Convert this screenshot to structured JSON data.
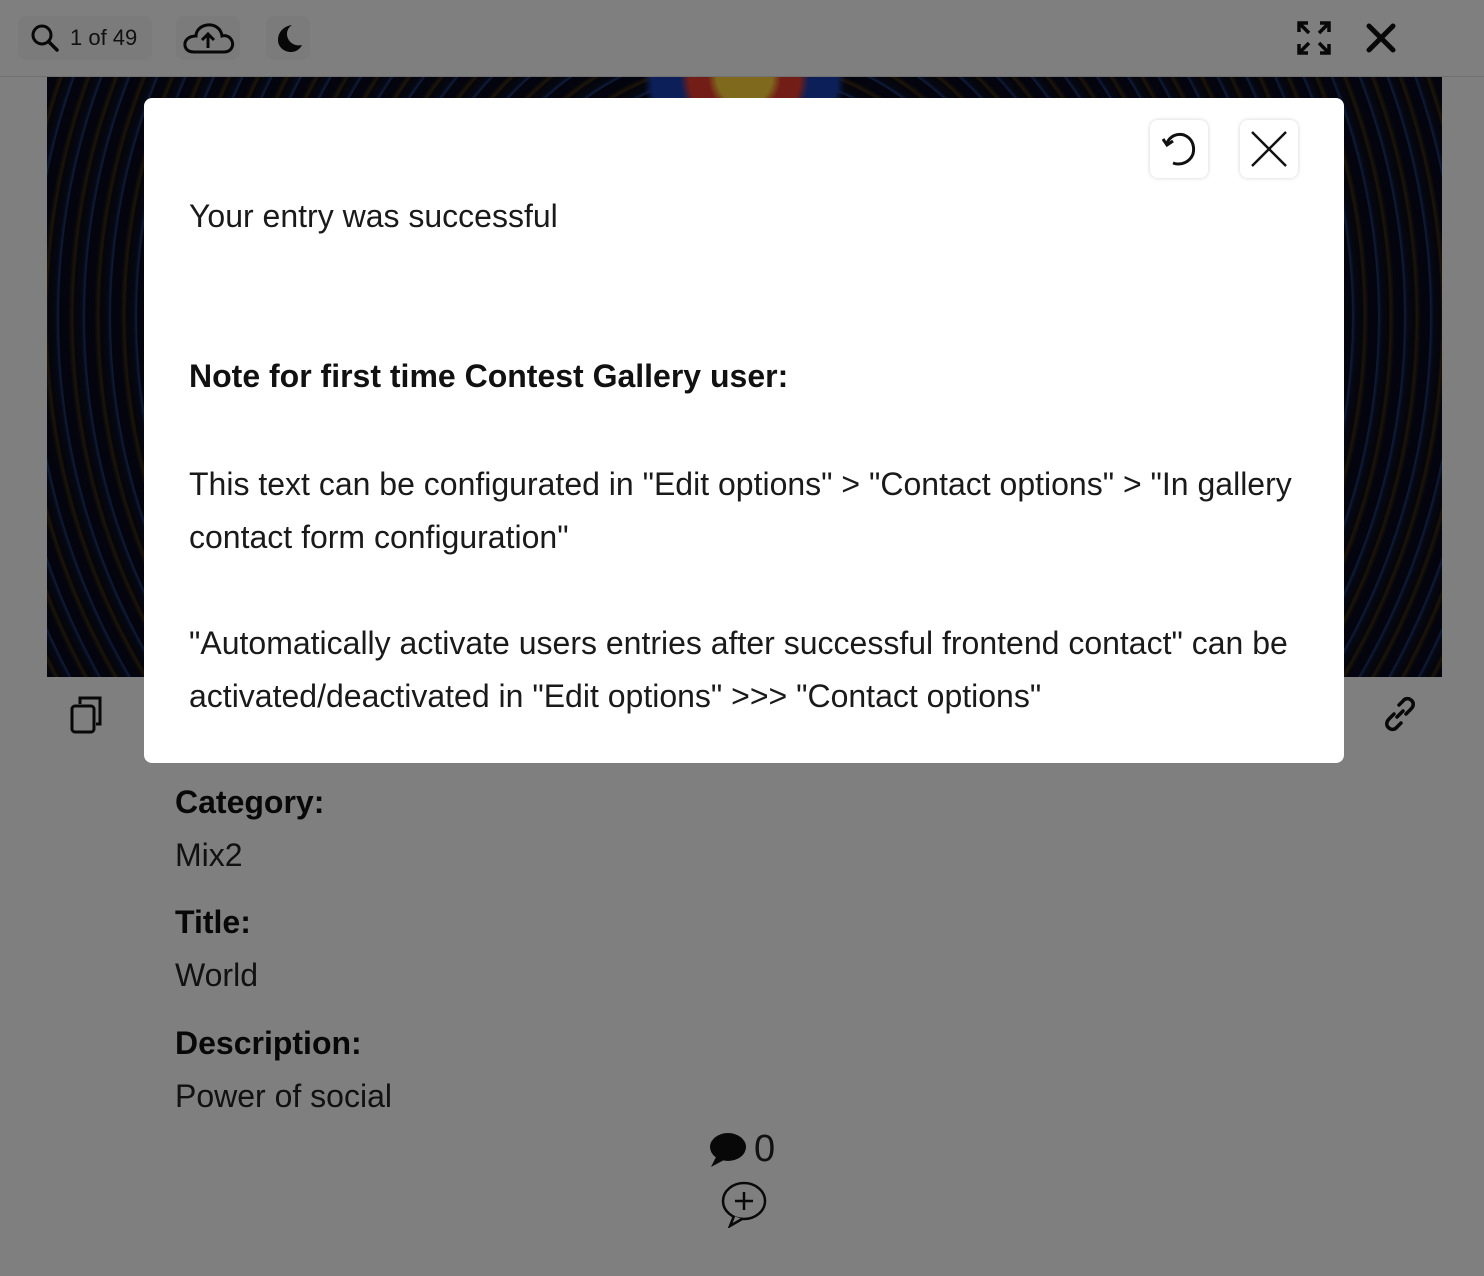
{
  "toolbar": {
    "counter_text": "1 of 49",
    "icons": [
      "search-icon",
      "cloud-upload-icon",
      "moon-icon",
      "fullscreen-icon",
      "close-icon"
    ]
  },
  "entry": {
    "category_label": "Category:",
    "category_value": "Mix2",
    "title_label": "Title:",
    "title_value": "World",
    "description_label": "Description:",
    "description_value": "Power of social"
  },
  "comments": {
    "count": "0"
  },
  "modal": {
    "success_message": "Your entry was successful",
    "note_heading": "Note for first time Contest Gallery user:",
    "paragraph_1": "This text can be configurated in \"Edit options\" > \"Contact options\" > \"In gallery contact form configuration\"",
    "paragraph_2": "\"Automatically activate users entries after successful frontend contact\" can be activated/deactivated in \"Edit options\" >>> \"Contact options\""
  },
  "colors": {
    "overlay": "#000000",
    "modal_bg": "#ffffff",
    "text": "#1a1a1a"
  }
}
